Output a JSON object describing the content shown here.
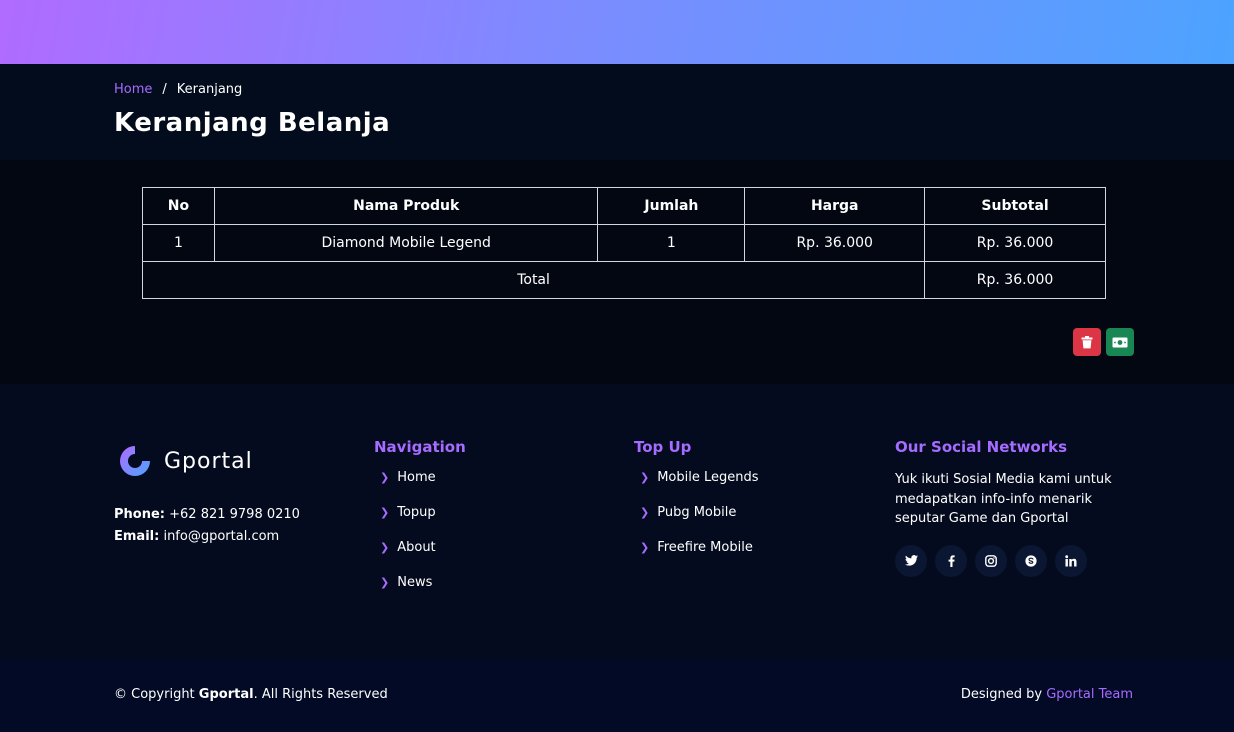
{
  "breadcrumb": {
    "home": "Home",
    "separator": "/",
    "current": "Keranjang"
  },
  "page_title": "Keranjang Belanja",
  "cart": {
    "headers": [
      "No",
      "Nama Produk",
      "Jumlah",
      "Harga",
      "Subtotal"
    ],
    "rows": [
      {
        "no": "1",
        "product": "Diamond Mobile Legend",
        "qty": "1",
        "price": "Rp. 36.000",
        "subtotal": "Rp. 36.000"
      }
    ],
    "total_label": "Total",
    "total_value": "Rp. 36.000"
  },
  "actions": {
    "delete_icon": "trash-icon",
    "pay_icon": "money-icon",
    "delete_color": "#dc3545",
    "pay_color": "#198754"
  },
  "footer": {
    "brand": "Gportal",
    "phone_label": "Phone:",
    "phone": "+62 821 9798 0210",
    "email_label": "Email:",
    "email": "info@gportal.com",
    "nav_title": "Navigation",
    "nav_items": [
      "Home",
      "Topup",
      "About",
      "News"
    ],
    "topup_title": "Top Up",
    "topup_items": [
      "Mobile Legends",
      "Pubg Mobile",
      "Freefire Mobile"
    ],
    "social_title": "Our Social Networks",
    "social_text": "Yuk ikuti Sosial Media kami untuk medapatkan info-info menarik seputar Game dan Gportal",
    "social_icons": [
      "twitter-icon",
      "facebook-icon",
      "instagram-icon",
      "skype-icon",
      "linkedin-icon"
    ]
  },
  "bottom": {
    "copyright_prefix": "© Copyright",
    "copyright_brand": "Gportal",
    "copyright_suffix": ". All Rights Reserved",
    "designed_by": "Designed by",
    "team": "Gportal Team"
  },
  "colors": {
    "accent": "#a66bff",
    "gradient_start": "#b06bff",
    "gradient_end": "#4da3ff"
  }
}
